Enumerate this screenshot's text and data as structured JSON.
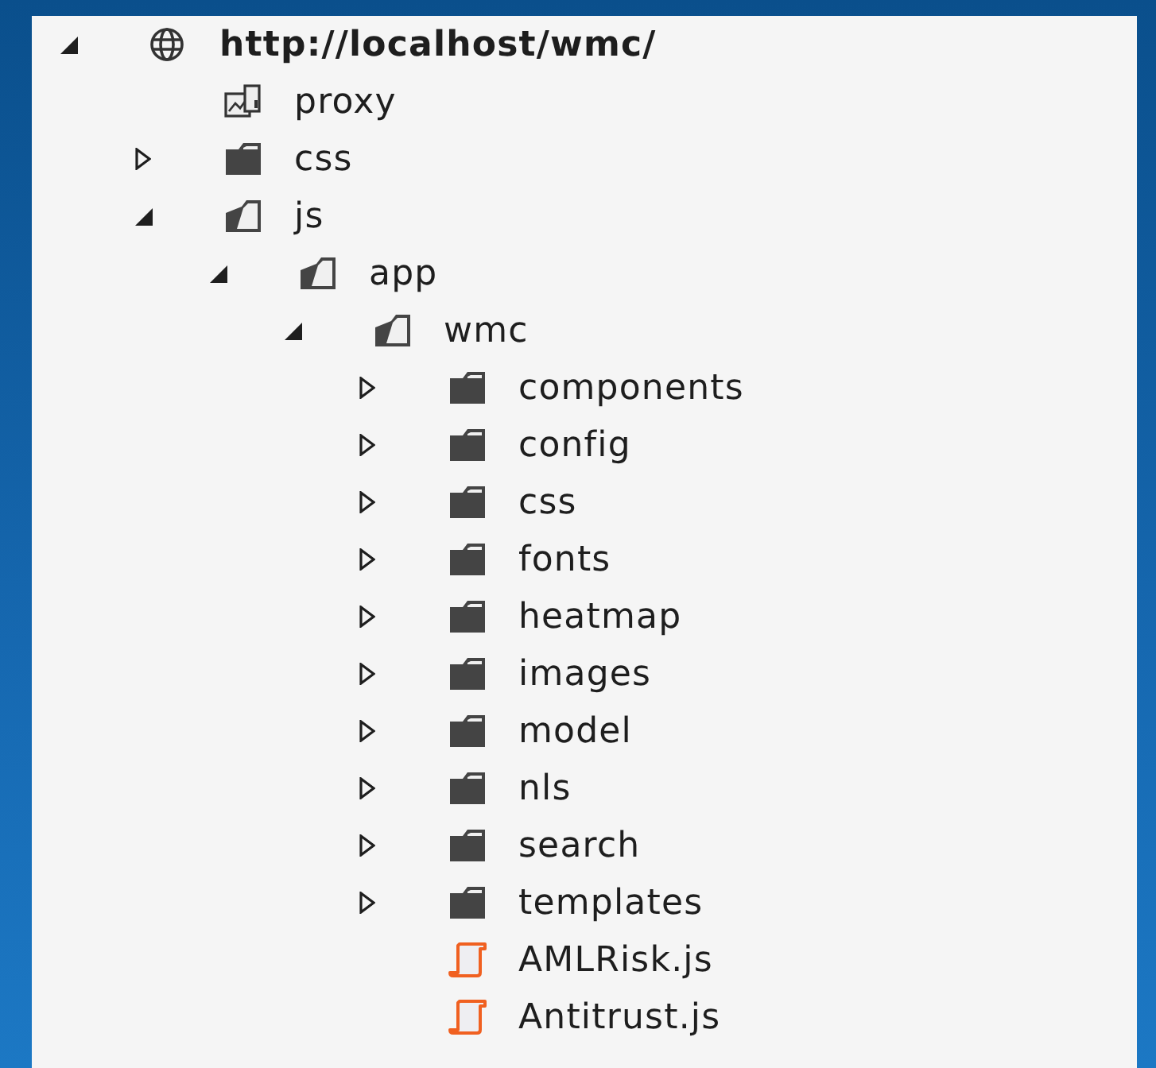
{
  "tree": [
    {
      "kind": "site",
      "label": "http://localhost/wmc/",
      "expanded": true,
      "children": [
        {
          "kind": "proxy",
          "label": "proxy"
        },
        {
          "kind": "folder",
          "label": "css",
          "expanded": false
        },
        {
          "kind": "folder",
          "label": "js",
          "expanded": true,
          "children": [
            {
              "kind": "folder",
              "label": "app",
              "expanded": true,
              "children": [
                {
                  "kind": "folder",
                  "label": "wmc",
                  "expanded": true,
                  "children": [
                    {
                      "kind": "folder",
                      "label": "components",
                      "expanded": false
                    },
                    {
                      "kind": "folder",
                      "label": "config",
                      "expanded": false
                    },
                    {
                      "kind": "folder",
                      "label": "css",
                      "expanded": false
                    },
                    {
                      "kind": "folder",
                      "label": "fonts",
                      "expanded": false
                    },
                    {
                      "kind": "folder",
                      "label": "heatmap",
                      "expanded": false
                    },
                    {
                      "kind": "folder",
                      "label": "images",
                      "expanded": false
                    },
                    {
                      "kind": "folder",
                      "label": "model",
                      "expanded": false
                    },
                    {
                      "kind": "folder",
                      "label": "nls",
                      "expanded": false
                    },
                    {
                      "kind": "folder",
                      "label": "search",
                      "expanded": false
                    },
                    {
                      "kind": "folder",
                      "label": "templates",
                      "expanded": false
                    },
                    {
                      "kind": "script",
                      "label": "AMLRisk.js"
                    },
                    {
                      "kind": "script",
                      "label": "Antitrust.js"
                    }
                  ]
                }
              ]
            }
          ]
        }
      ]
    }
  ]
}
